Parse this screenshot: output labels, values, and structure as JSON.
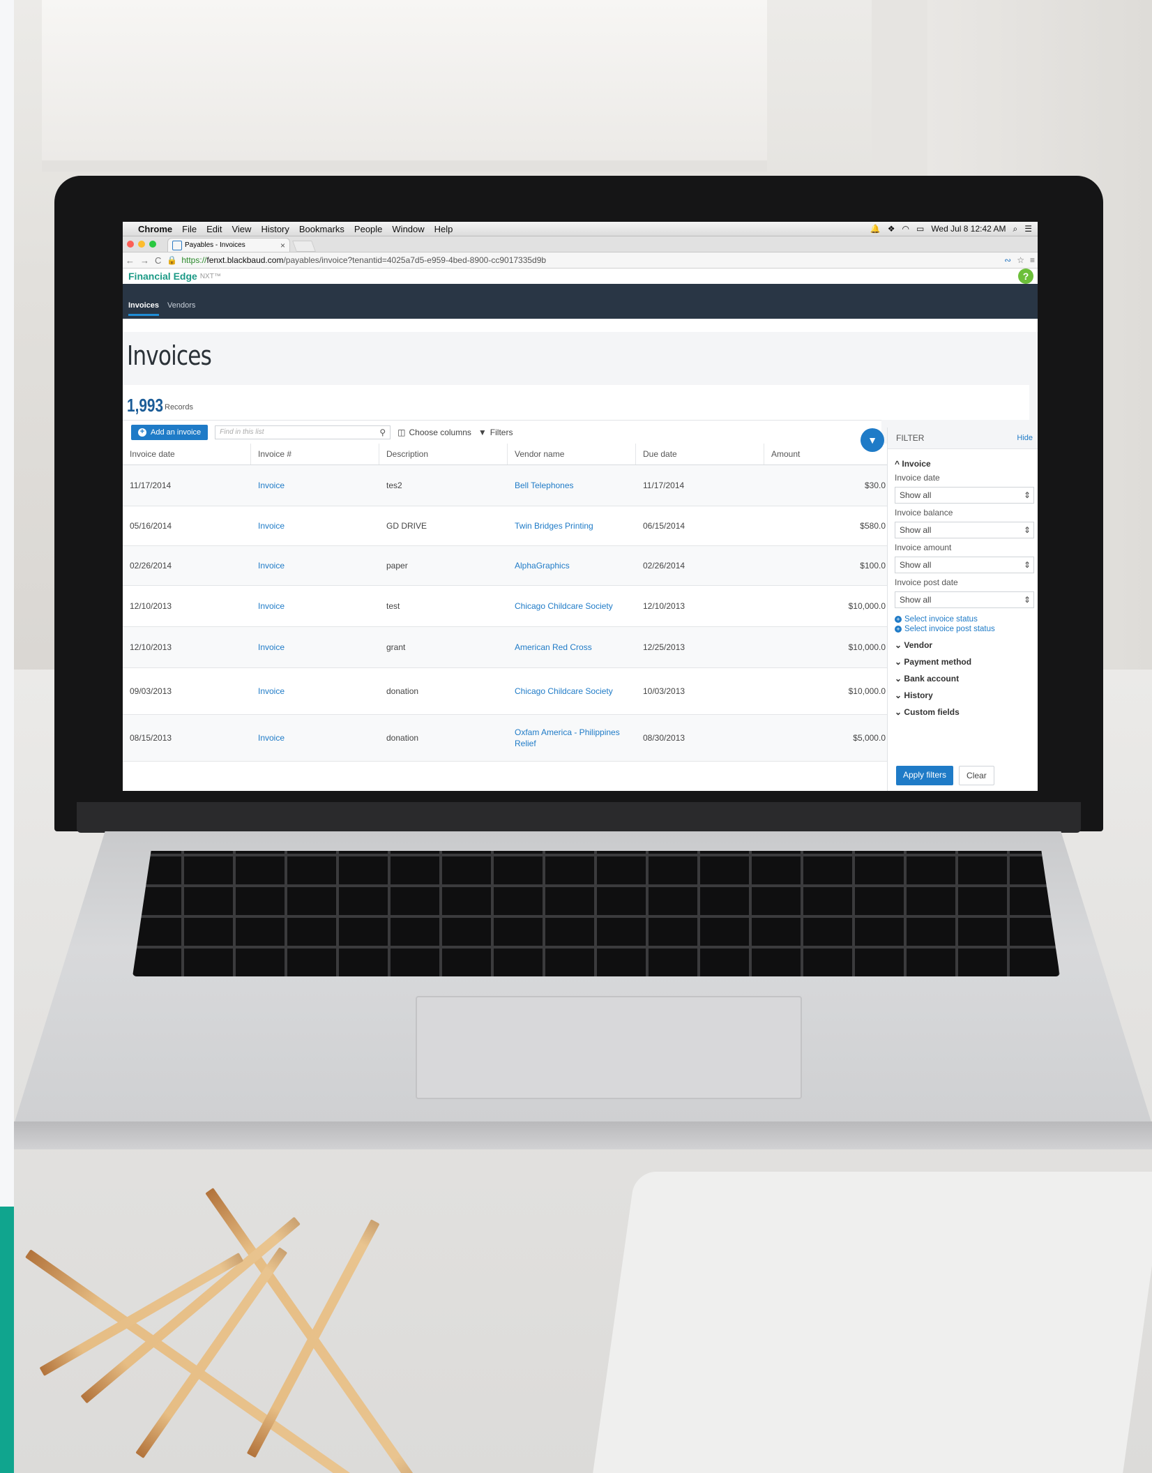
{
  "macos_menubar": {
    "apple": "",
    "app": "Chrome",
    "menus": [
      "File",
      "Edit",
      "View",
      "History",
      "Bookmarks",
      "People",
      "Window",
      "Help"
    ],
    "clock": "Wed Jul 8  12:42 AM"
  },
  "browser": {
    "tab_title": "Payables - Invoices",
    "tab_close": "×",
    "url_https": "https://",
    "url_host": "fenxt.blackbaud.com",
    "url_path": "/payables/invoice?tenantid=4025a7d5-e959-4bed-8900-cc9017335d9b"
  },
  "app": {
    "brand": "Financial Edge",
    "brand_suffix": "NXT™",
    "help": "?"
  },
  "nav": {
    "tabs": [
      {
        "label": "Invoices",
        "active": true
      },
      {
        "label": "Vendors",
        "active": false
      }
    ]
  },
  "page": {
    "title": "Invoices",
    "records_count": "1,993",
    "records_label": "Records"
  },
  "toolbar": {
    "add_label": "Add an invoice",
    "search_placeholder": "Find in this list",
    "choose_columns": "Choose columns",
    "filters": "Filters"
  },
  "grid": {
    "columns": [
      "Invoice date",
      "Invoice #",
      "Description",
      "Vendor name",
      "Due date",
      "Amount"
    ],
    "rows": [
      {
        "invoice_date": "11/17/2014",
        "invoice_no": "Invoice",
        "description": "tes2",
        "vendor": "Bell Telephones",
        "due_date": "11/17/2014",
        "amount": "$30.0"
      },
      {
        "invoice_date": "05/16/2014",
        "invoice_no": "Invoice",
        "description": "GD DRIVE",
        "vendor": "Twin Bridges Printing",
        "due_date": "06/15/2014",
        "amount": "$580.0"
      },
      {
        "invoice_date": "02/26/2014",
        "invoice_no": "Invoice",
        "description": "paper",
        "vendor": "AlphaGraphics",
        "due_date": "02/26/2014",
        "amount": "$100.0"
      },
      {
        "invoice_date": "12/10/2013",
        "invoice_no": "Invoice",
        "description": "test",
        "vendor": "Chicago Childcare Society",
        "due_date": "12/10/2013",
        "amount": "$10,000.0"
      },
      {
        "invoice_date": "12/10/2013",
        "invoice_no": "Invoice",
        "description": "grant",
        "vendor": "American Red Cross",
        "due_date": "12/25/2013",
        "amount": "$10,000.0"
      },
      {
        "invoice_date": "09/03/2013",
        "invoice_no": "Invoice",
        "description": "donation",
        "vendor": "Chicago Childcare Society",
        "due_date": "10/03/2013",
        "amount": "$10,000.0"
      },
      {
        "invoice_date": "08/15/2013",
        "invoice_no": "Invoice",
        "description": "donation",
        "vendor": "Oxfam America - Philippines Relief",
        "due_date": "08/30/2013",
        "amount": "$5,000.0"
      }
    ]
  },
  "filter_panel": {
    "title": "FILTER",
    "hide": "Hide",
    "section": "Invoice",
    "fields": [
      {
        "label": "Invoice date",
        "value": "Show all"
      },
      {
        "label": "Invoice balance",
        "value": "Show all"
      },
      {
        "label": "Invoice amount",
        "value": "Show all"
      },
      {
        "label": "Invoice post date",
        "value": "Show all"
      }
    ],
    "links": [
      "Select invoice status",
      "Select invoice post status"
    ],
    "collapsed_sections": [
      "Vendor",
      "Payment method",
      "Bank account",
      "History",
      "Custom fields"
    ],
    "apply": "Apply filters",
    "clear": "Clear"
  },
  "colors": {
    "accent": "#1f7bc7",
    "brand": "#1c9a86",
    "navbar": "#293645",
    "teal_strip": "#10a58e"
  }
}
